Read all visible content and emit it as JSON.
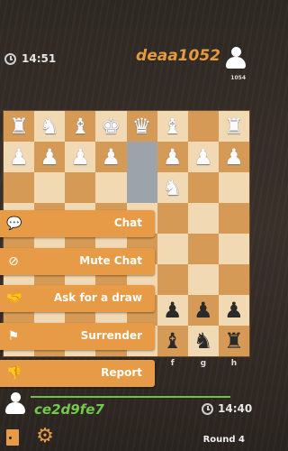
{
  "opponent": {
    "time": "14:51",
    "name": "deaa1052",
    "rating": "1054"
  },
  "player": {
    "time": "14:40",
    "name": "ce2d9fe7"
  },
  "board": {
    "files": [
      "",
      "",
      "",
      "",
      "",
      "f",
      "g",
      "h"
    ],
    "pieces": [
      {
        "glyph": "♜",
        "color": "w",
        "row": 0,
        "col": 0
      },
      {
        "glyph": "♞",
        "color": "w",
        "row": 0,
        "col": 1
      },
      {
        "glyph": "♝",
        "color": "w",
        "row": 0,
        "col": 2
      },
      {
        "glyph": "♚",
        "color": "w",
        "row": 0,
        "col": 3
      },
      {
        "glyph": "♛",
        "color": "w",
        "row": 0,
        "col": 4
      },
      {
        "glyph": "♝",
        "color": "w",
        "row": 0,
        "col": 5
      },
      {
        "glyph": "♜",
        "color": "w",
        "row": 0,
        "col": 7
      },
      {
        "glyph": "♟",
        "color": "w",
        "row": 1,
        "col": 0
      },
      {
        "glyph": "♟",
        "color": "w",
        "row": 1,
        "col": 1
      },
      {
        "glyph": "♟",
        "color": "w",
        "row": 1,
        "col": 2
      },
      {
        "glyph": "♟",
        "color": "w",
        "row": 1,
        "col": 3
      },
      {
        "glyph": "♟",
        "color": "w",
        "row": 1,
        "col": 5
      },
      {
        "glyph": "♟",
        "color": "w",
        "row": 1,
        "col": 6
      },
      {
        "glyph": "♟",
        "color": "w",
        "row": 1,
        "col": 7
      },
      {
        "glyph": "♞",
        "color": "w",
        "row": 2,
        "col": 5
      },
      {
        "glyph": "♟",
        "color": "b",
        "row": 6,
        "col": 5
      },
      {
        "glyph": "♟",
        "color": "b",
        "row": 6,
        "col": 6
      },
      {
        "glyph": "♟",
        "color": "b",
        "row": 6,
        "col": 7
      },
      {
        "glyph": "♝",
        "color": "b",
        "row": 7,
        "col": 5
      },
      {
        "glyph": "♞",
        "color": "b",
        "row": 7,
        "col": 6
      },
      {
        "glyph": "♜",
        "color": "b",
        "row": 7,
        "col": 7
      }
    ],
    "highlighted": [
      {
        "row": 1,
        "col": 4
      },
      {
        "row": 2,
        "col": 4
      }
    ]
  },
  "menu": {
    "chat": {
      "label": "Chat",
      "icon": "speech-bubble-icon"
    },
    "mute_chat": {
      "label": "Mute Chat",
      "icon": "muted-bubble-icon"
    },
    "draw": {
      "label": "Ask for a draw",
      "icon": "handshake-icon"
    },
    "surrender": {
      "label": "Surrender",
      "icon": "flag-icon"
    },
    "report": {
      "label": "Report",
      "icon": "thumbs-down-icon"
    }
  },
  "footer": {
    "round": "Round 4"
  },
  "colors": {
    "accent": "#e89b46",
    "player_name": "#74c94c",
    "opponent_name": "#e59a3e",
    "light_square": "#f1d9b4",
    "dark_square": "#d49a56"
  }
}
